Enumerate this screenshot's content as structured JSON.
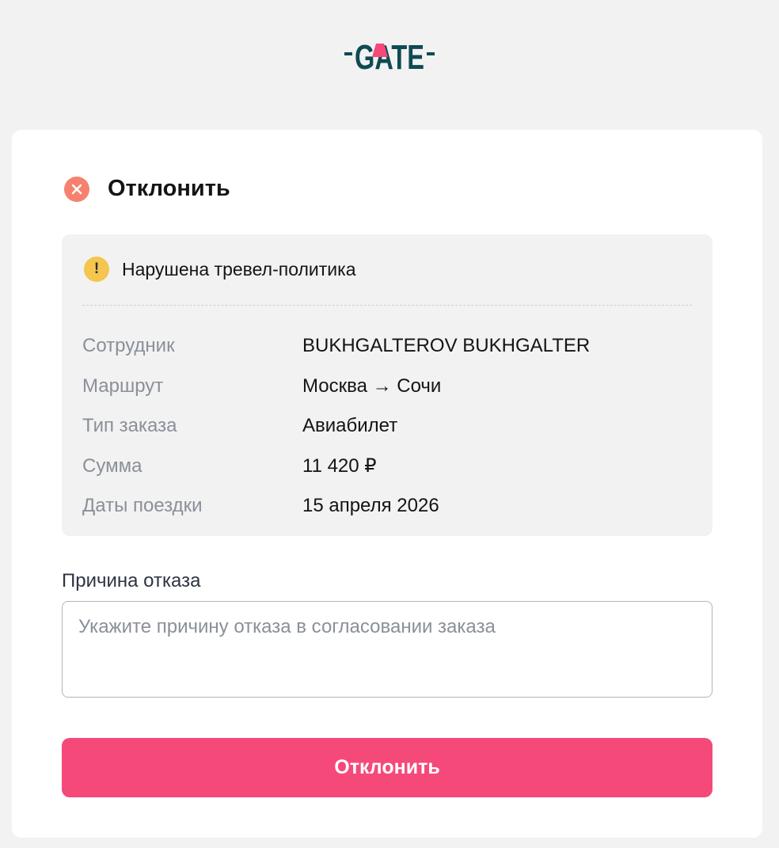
{
  "brand": {
    "logo_text": "GATE",
    "colors": {
      "logo_dark": "#0f4a52",
      "logo_accent": "#f5497a"
    }
  },
  "dialog": {
    "title": "Отклонить",
    "title_icon": "close-circle-icon",
    "title_icon_color": "#f5826f"
  },
  "warning": {
    "icon": "exclamation-circle-icon",
    "icon_color": "#f4c54f",
    "icon_symbol": "!",
    "text": "Нарушена тревел-политика"
  },
  "details": [
    {
      "label": "Сотрудник",
      "value": "BUKHGALTEROV BUKHGALTER"
    },
    {
      "label": "Маршрут",
      "value": "Москва → Сочи"
    },
    {
      "label": "Тип заказа",
      "value": "Авиабилет"
    },
    {
      "label": "Сумма",
      "value": "11 420 ₽"
    },
    {
      "label": "Даты поездки",
      "value": "15 апреля 2026"
    }
  ],
  "reason": {
    "label": "Причина отказа",
    "placeholder": "Укажите причину отказа в согласовании заказа",
    "value": ""
  },
  "submit": {
    "label": "Отклонить",
    "color": "#f5497a"
  }
}
